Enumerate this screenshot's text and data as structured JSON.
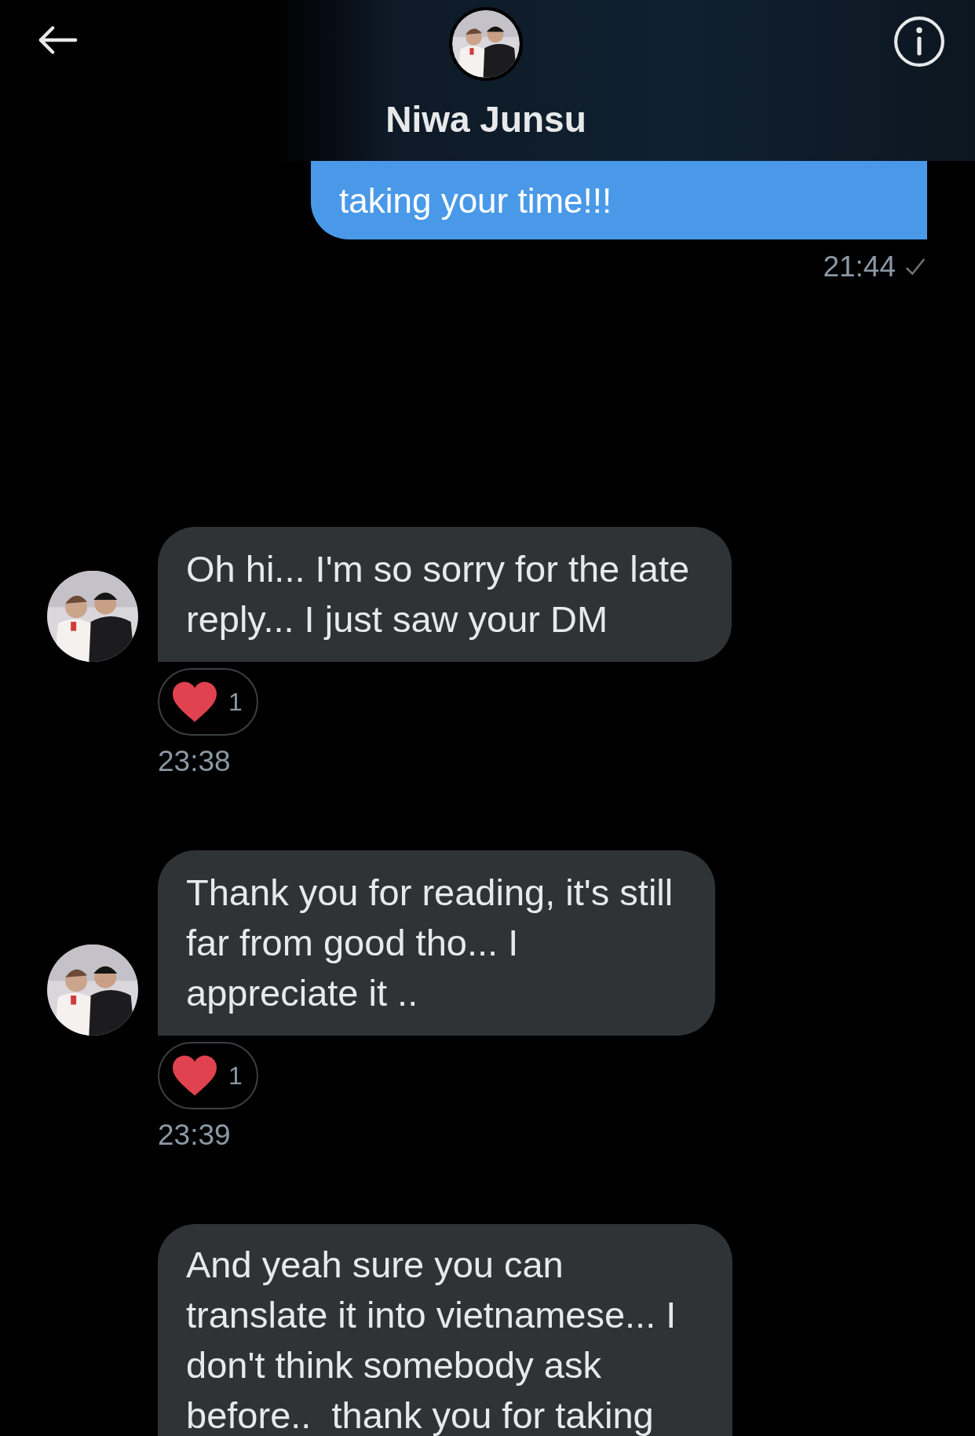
{
  "header": {
    "title": "Niwa Junsu"
  },
  "messages": [
    {
      "kind": "sent",
      "text": "taking your time!!!",
      "time": "21:44",
      "read": true
    },
    {
      "kind": "received",
      "text": "Oh hi... I'm so sorry for the late\nreply... I just saw your DM",
      "liked": true,
      "reaction_count": "1",
      "time": "23:38"
    },
    {
      "kind": "received",
      "text": "Thank you for reading, it's still\nfar from good tho... I\nappreciate it ..",
      "liked": true,
      "reaction_count": "1",
      "time": "23:39"
    },
    {
      "kind": "received_open",
      "text": "And yeah sure you can\ntranslate it into vietnamese... I\ndon't think somebody ask\nbefore..  thank you for taking"
    }
  ]
}
